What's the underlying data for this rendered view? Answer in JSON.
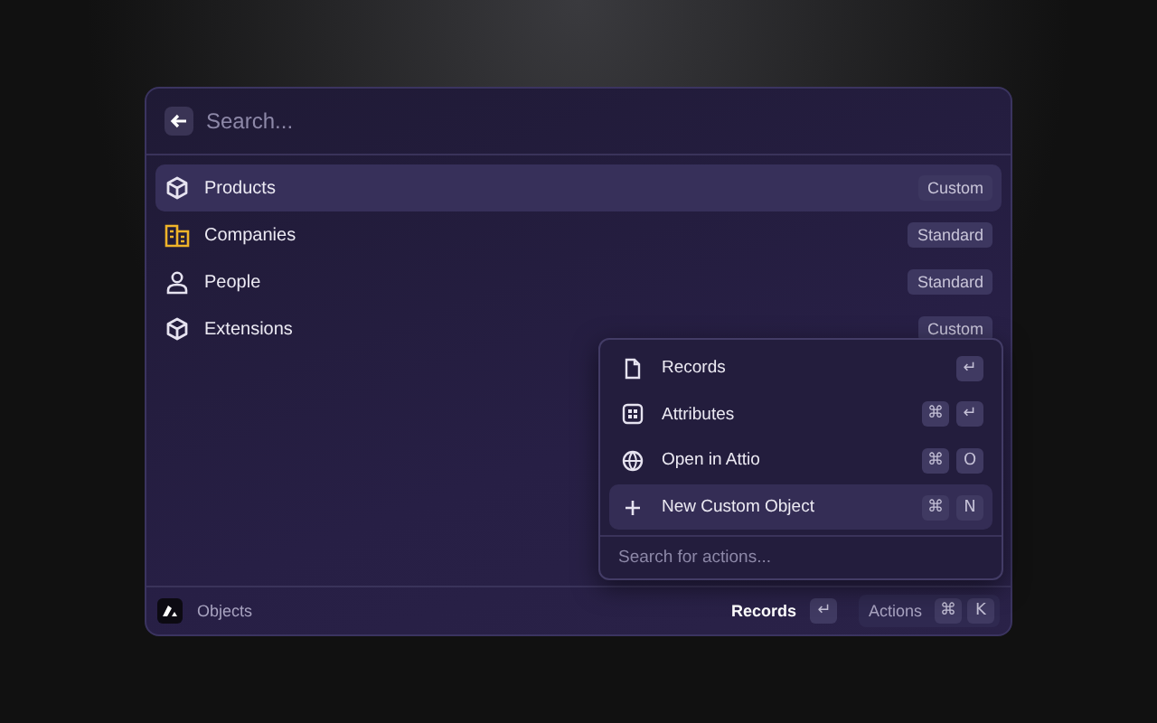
{
  "search": {
    "placeholder": "Search..."
  },
  "items": [
    {
      "label": "Products",
      "kind": "cube",
      "badge": "Custom",
      "selected": true
    },
    {
      "label": "Companies",
      "kind": "building",
      "badge": "Standard",
      "selected": false
    },
    {
      "label": "People",
      "kind": "person",
      "badge": "Standard",
      "selected": false
    },
    {
      "label": "Extensions",
      "kind": "cube",
      "badge": "Custom",
      "selected": false
    }
  ],
  "actions_menu": {
    "items": [
      {
        "label": "Records",
        "kind": "document",
        "keys": [
          "↵"
        ],
        "selected": false
      },
      {
        "label": "Attributes",
        "kind": "grid",
        "keys": [
          "⌘",
          "↵"
        ],
        "selected": false
      },
      {
        "label": "Open in Attio",
        "kind": "globe",
        "keys": [
          "⌘",
          "O"
        ],
        "selected": false
      },
      {
        "label": "New Custom Object",
        "kind": "add",
        "keys": [
          "⌘",
          "N"
        ],
        "selected": true
      }
    ],
    "search_placeholder": "Search for actions..."
  },
  "footer": {
    "title": "Objects",
    "primary_label": "Records",
    "primary_keys": [
      "↵"
    ],
    "actions_label": "Actions",
    "actions_keys": [
      "⌘",
      "K"
    ]
  }
}
